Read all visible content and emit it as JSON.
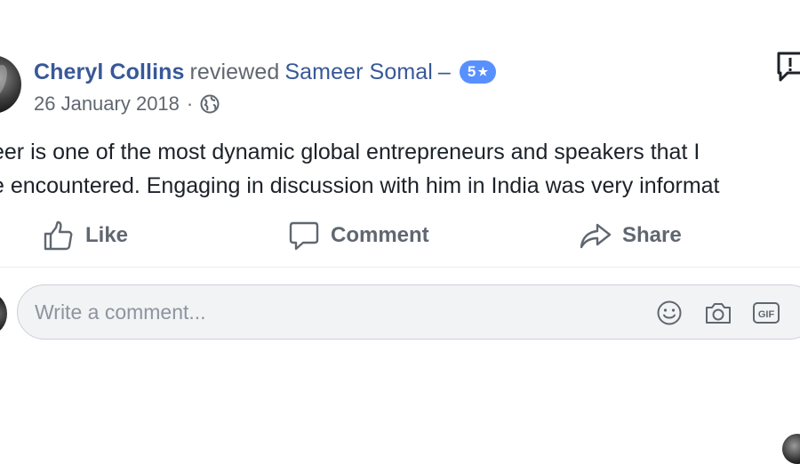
{
  "post": {
    "author": "Cheryl Collins",
    "verb": "reviewed",
    "page": "Sameer Somal",
    "dash": "–",
    "rating": "5",
    "rating_star": "★",
    "date": "26 January 2018",
    "date_separator": "·",
    "privacy_icon": "globe-icon",
    "report_icon": "report-icon",
    "text_lines": [
      "eer is one of the most dynamic global entrepreneurs and speakers that I",
      "e encountered. Engaging in discussion with him in India was very informat"
    ]
  },
  "actions": {
    "like_label": "Like",
    "comment_label": "Comment",
    "share_label": "Share"
  },
  "comment_box": {
    "placeholder": "Write a comment...",
    "icons": [
      "emoji-icon",
      "camera-icon",
      "gif-icon"
    ]
  },
  "colors": {
    "link": "#385898",
    "meta_text": "#616770",
    "rating_badge": "#5890ff",
    "action_text": "#606770",
    "comment_box_bg": "#f2f3f5"
  }
}
